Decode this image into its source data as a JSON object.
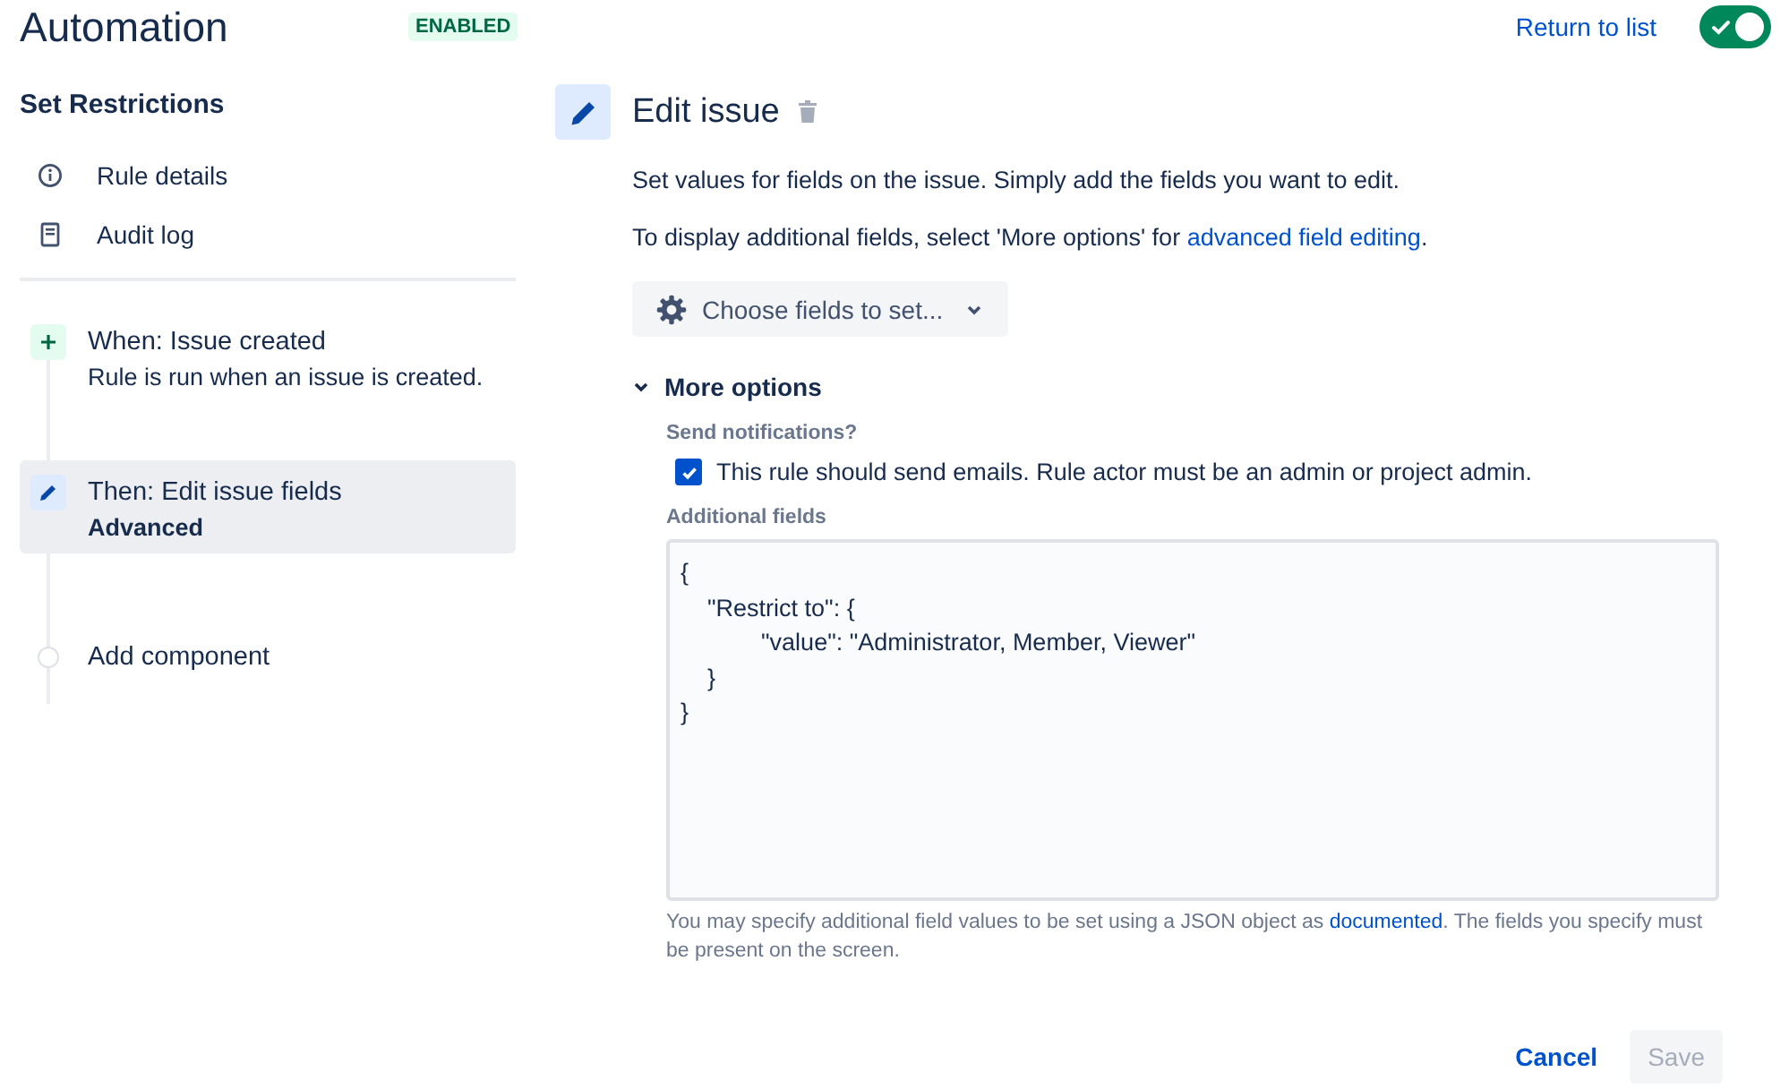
{
  "header": {
    "title": "Automation",
    "badge": "ENABLED",
    "return_link": "Return to list",
    "toggle": {
      "on": true
    }
  },
  "sidebar": {
    "heading": "Set Restrictions",
    "items": [
      {
        "label": "Rule details"
      },
      {
        "label": "Audit log"
      }
    ],
    "steps": [
      {
        "kind": "trigger",
        "title": "When: Issue created",
        "subtitle": "Rule is run when an issue is created.",
        "selected": false
      },
      {
        "kind": "action",
        "title": "Then: Edit issue fields",
        "subtitle": "Advanced",
        "selected": true
      },
      {
        "kind": "add",
        "title": "Add component",
        "selected": false
      }
    ]
  },
  "editor": {
    "title": "Edit issue",
    "intro": "Set values for fields on the issue. Simply add the fields you want to edit.",
    "hint": {
      "before": "To display additional fields, select 'More options' for ",
      "link": "advanced field editing",
      "after": "."
    },
    "choose_button": "Choose fields to set...",
    "more_options": {
      "label": "More options",
      "expanded": true
    },
    "notifications": {
      "label": "Send notifications?",
      "checkbox": {
        "label": "This rule should send emails. Rule actor must be an admin or project admin.",
        "checked": true
      }
    },
    "additional": {
      "label": "Additional fields",
      "value": "{\n    \"Restrict to\": {\n            \"value\": \"Administrator, Member, Viewer\"\n    }\n}",
      "help": {
        "before": "You may specify additional field values to be set using a JSON object as ",
        "link": "documented",
        "after": ". The fields you specify must be present on the screen."
      }
    },
    "buttons": [
      {
        "label": "Cancel",
        "kind": "link",
        "disabled": false
      },
      {
        "label": "Save",
        "kind": "primary",
        "disabled": true
      }
    ]
  }
}
